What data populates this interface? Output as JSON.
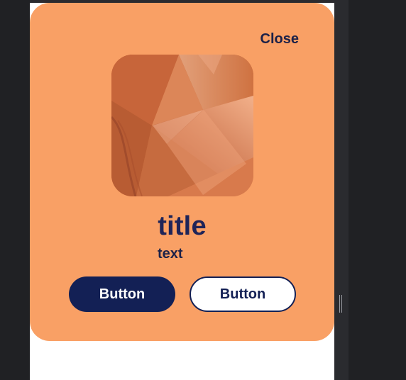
{
  "modal": {
    "close_label": "Close",
    "title": "title",
    "text": "text",
    "primary_button_label": "Button",
    "secondary_button_label": "Button"
  },
  "colors": {
    "modal_background": "#f9a065",
    "primary_button": "#132055",
    "button_text_light": "#ffffff",
    "outer_background": "#202124",
    "inner_panel": "#ffffff"
  },
  "icons": {
    "close": "close-icon"
  }
}
